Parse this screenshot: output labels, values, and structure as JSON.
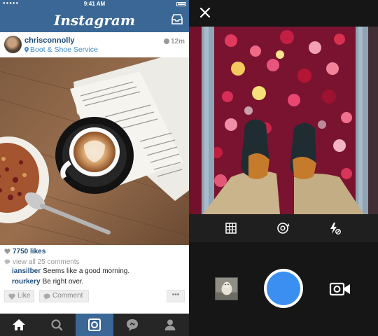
{
  "feed": {
    "status_bar": {
      "signal": "●●●●●",
      "time": "9:41 AM"
    },
    "nav": {
      "title": "Instagram",
      "inbox_icon": "inbox-tray-icon"
    },
    "post": {
      "username": "chrisconnolly",
      "location": "Boot & Shoe Service",
      "time_ago": "12m",
      "likes": "7750 likes",
      "view_comments": "view all 25 comments",
      "comments": [
        {
          "user": "iansilber",
          "text": "Seems like a good morning."
        },
        {
          "user": "rourkery",
          "text": "Be right over."
        }
      ],
      "like_label": "Like",
      "comment_label": "Comment",
      "more_label": "•••"
    },
    "tabs": [
      {
        "name": "home",
        "icon": "home-icon",
        "active": false
      },
      {
        "name": "explore",
        "icon": "search-icon",
        "active": false
      },
      {
        "name": "camera",
        "icon": "camera-icon",
        "active": true
      },
      {
        "name": "news",
        "icon": "speech-bubble-icon",
        "active": false
      },
      {
        "name": "profile",
        "icon": "profile-icon",
        "active": false
      }
    ],
    "colors": {
      "brand": "#3a6796",
      "link": "#1d4d7b",
      "location": "#3f8ccf"
    }
  },
  "camera": {
    "close_icon": "close-icon",
    "tools": [
      {
        "name": "grid",
        "icon": "grid-icon"
      },
      {
        "name": "flip-camera",
        "icon": "flip-camera-icon"
      },
      {
        "name": "flash-off",
        "icon": "flash-off-icon"
      }
    ],
    "shutter_color": "#3a8ff0",
    "gallery_icon": "gallery-thumbnail",
    "video_icon": "video-camera-icon"
  }
}
